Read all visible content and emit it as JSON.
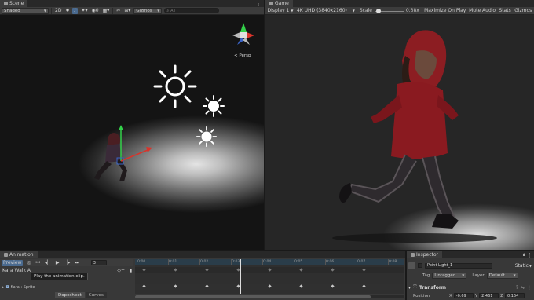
{
  "scene": {
    "tab_label": "Scene",
    "shading_mode": "Shaded",
    "mode_2d": "2D",
    "hidden_count": "0",
    "gizmos_label": "Gizmos",
    "search_placeholder": "All",
    "persp_label": "< Persp"
  },
  "game": {
    "tab_label": "Game",
    "display": "Display 1",
    "resolution": "4K UHD (3840x2160)",
    "scale_label": "Scale",
    "scale_value": "0.38x",
    "maximize": "Maximize On Play",
    "mute": "Mute Audio",
    "stats": "Stats",
    "gizmos": "Gizmos"
  },
  "animation": {
    "tab_label": "Animation",
    "preview_label": "Preview",
    "frame": "3",
    "clip_name": "Kara Walk A",
    "tooltip": "Play the animation clip.",
    "property_label": "Kara : Sprite",
    "dopesheet_tab": "Dopesheet",
    "curves_tab": "Curves",
    "ticks": [
      "0:00",
      "0:01",
      "0:02",
      "0:03",
      "0:04",
      "0:05",
      "0:06",
      "0:07",
      "0:08"
    ]
  },
  "inspector": {
    "tab_label": "Inspector",
    "object_name": "Point Light_1",
    "static_label": "Static",
    "tag_label": "Tag",
    "tag_value": "Untagged",
    "layer_label": "Layer",
    "layer_value": "Default",
    "component": "Transform",
    "position_label": "Position",
    "pos_x_label": "X",
    "pos_x": "-0.69",
    "pos_y_label": "Y",
    "pos_y": "2.461",
    "pos_z_label": "Z",
    "pos_z": "0.164"
  }
}
